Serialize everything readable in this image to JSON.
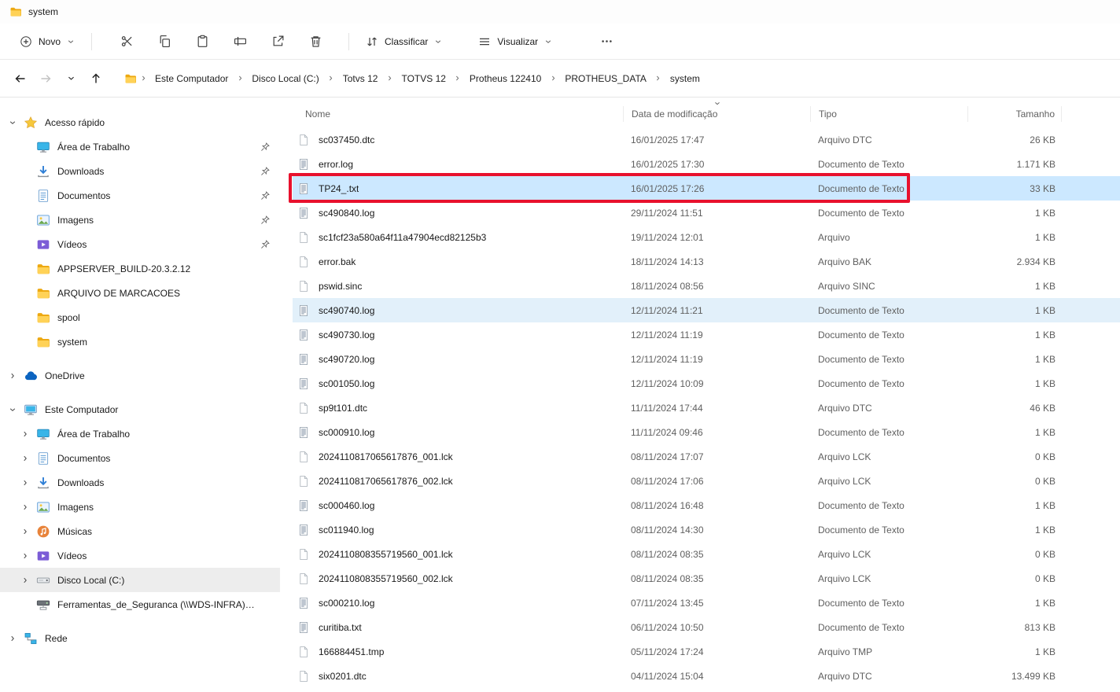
{
  "window": {
    "title": "system"
  },
  "toolbar": {
    "new": {
      "label": "Novo"
    },
    "sort": {
      "label": "Classificar"
    },
    "view": {
      "label": "Visualizar"
    }
  },
  "breadcrumb": {
    "items": [
      "Este Computador",
      "Disco Local (C:)",
      "Totvs 12",
      "TOTVS 12",
      "Protheus 122410",
      "PROTHEUS_DATA",
      "system"
    ]
  },
  "sidebar": {
    "items": [
      {
        "label": "Acesso rápido",
        "depth": 0,
        "icon": "star",
        "chevron": "down"
      },
      {
        "label": "Área de Trabalho",
        "depth": 1,
        "icon": "desktop",
        "pinned": true
      },
      {
        "label": "Downloads",
        "depth": 1,
        "icon": "downloads",
        "pinned": true
      },
      {
        "label": "Documentos",
        "depth": 1,
        "icon": "documents",
        "pinned": true
      },
      {
        "label": "Imagens",
        "depth": 1,
        "icon": "pictures",
        "pinned": true
      },
      {
        "label": "Vídeos",
        "depth": 1,
        "icon": "videos",
        "pinned": true
      },
      {
        "label": "APPSERVER_BUILD-20.3.2.12",
        "depth": 1,
        "icon": "folder"
      },
      {
        "label": "ARQUIVO DE MARCACOES",
        "depth": 1,
        "icon": "folder"
      },
      {
        "label": "spool",
        "depth": 1,
        "icon": "folder"
      },
      {
        "label": "system",
        "depth": 1,
        "icon": "folder"
      },
      {
        "label": "OneDrive",
        "depth": 0,
        "icon": "cloud",
        "chevron": "right",
        "gap": true
      },
      {
        "label": "Este Computador",
        "depth": 0,
        "icon": "computer",
        "chevron": "down",
        "gap": true
      },
      {
        "label": "Área de Trabalho",
        "depth": 1,
        "icon": "desktop",
        "chevron": "right"
      },
      {
        "label": "Documentos",
        "depth": 1,
        "icon": "documents",
        "chevron": "right"
      },
      {
        "label": "Downloads",
        "depth": 1,
        "icon": "downloads",
        "chevron": "right"
      },
      {
        "label": "Imagens",
        "depth": 1,
        "icon": "pictures",
        "chevron": "right"
      },
      {
        "label": "Músicas",
        "depth": 1,
        "icon": "music",
        "chevron": "right"
      },
      {
        "label": "Vídeos",
        "depth": 1,
        "icon": "videos",
        "chevron": "right"
      },
      {
        "label": "Disco Local (C:)",
        "depth": 1,
        "icon": "drive",
        "chevron": "right",
        "selected": true
      },
      {
        "label": "Ferramentas_de_Seguranca (\\\\WDS-INFRA) (K:)",
        "depth": 1,
        "icon": "netdrive"
      },
      {
        "label": "Rede",
        "depth": 0,
        "icon": "network",
        "chevron": "right",
        "gap": true
      }
    ]
  },
  "files": {
    "columns": [
      {
        "key": "name",
        "label": "Nome"
      },
      {
        "key": "date",
        "label": "Data de modificação",
        "sort": "desc"
      },
      {
        "key": "type",
        "label": "Tipo"
      },
      {
        "key": "size",
        "label": "Tamanho"
      }
    ],
    "rows": [
      {
        "name": "sc037450.dtc",
        "date": "16/01/2025 17:47",
        "type": "Arquivo DTC",
        "size": "26 KB",
        "icon": "file-blank"
      },
      {
        "name": "error.log",
        "date": "16/01/2025 17:30",
        "type": "Documento de Texto",
        "size": "1.171 KB",
        "icon": "file-text"
      },
      {
        "name": "TP24_.txt",
        "date": "16/01/2025 17:26",
        "type": "Documento de Texto",
        "size": "33 KB",
        "icon": "file-text",
        "state": "selected"
      },
      {
        "name": "sc490840.log",
        "date": "29/11/2024 11:51",
        "type": "Documento de Texto",
        "size": "1 KB",
        "icon": "file-text"
      },
      {
        "name": "sc1fcf23a580a64f11a47904ecd82125b3",
        "date": "19/11/2024 12:01",
        "type": "Arquivo",
        "size": "1 KB",
        "icon": "file-blank"
      },
      {
        "name": "error.bak",
        "date": "18/11/2024 14:13",
        "type": "Arquivo BAK",
        "size": "2.934 KB",
        "icon": "file-blank"
      },
      {
        "name": "pswid.sinc",
        "date": "18/11/2024 08:56",
        "type": "Arquivo SINC",
        "size": "1 KB",
        "icon": "file-blank"
      },
      {
        "name": "sc490740.log",
        "date": "12/11/2024 11:21",
        "type": "Documento de Texto",
        "size": "1 KB",
        "icon": "file-text",
        "state": "highlighted"
      },
      {
        "name": "sc490730.log",
        "date": "12/11/2024 11:19",
        "type": "Documento de Texto",
        "size": "1 KB",
        "icon": "file-text"
      },
      {
        "name": "sc490720.log",
        "date": "12/11/2024 11:19",
        "type": "Documento de Texto",
        "size": "1 KB",
        "icon": "file-text"
      },
      {
        "name": "sc001050.log",
        "date": "12/11/2024 10:09",
        "type": "Documento de Texto",
        "size": "1 KB",
        "icon": "file-text"
      },
      {
        "name": "sp9t101.dtc",
        "date": "11/11/2024 17:44",
        "type": "Arquivo DTC",
        "size": "46 KB",
        "icon": "file-blank"
      },
      {
        "name": "sc000910.log",
        "date": "11/11/2024 09:46",
        "type": "Documento de Texto",
        "size": "1 KB",
        "icon": "file-text"
      },
      {
        "name": "2024110817065617876_001.lck",
        "date": "08/11/2024 17:07",
        "type": "Arquivo LCK",
        "size": "0 KB",
        "icon": "file-blank"
      },
      {
        "name": "2024110817065617876_002.lck",
        "date": "08/11/2024 17:06",
        "type": "Arquivo LCK",
        "size": "0 KB",
        "icon": "file-blank"
      },
      {
        "name": "sc000460.log",
        "date": "08/11/2024 16:48",
        "type": "Documento de Texto",
        "size": "1 KB",
        "icon": "file-text"
      },
      {
        "name": "sc011940.log",
        "date": "08/11/2024 14:30",
        "type": "Documento de Texto",
        "size": "1 KB",
        "icon": "file-text"
      },
      {
        "name": "2024110808355719560_001.lck",
        "date": "08/11/2024 08:35",
        "type": "Arquivo LCK",
        "size": "0 KB",
        "icon": "file-blank"
      },
      {
        "name": "2024110808355719560_002.lck",
        "date": "08/11/2024 08:35",
        "type": "Arquivo LCK",
        "size": "0 KB",
        "icon": "file-blank"
      },
      {
        "name": "sc000210.log",
        "date": "07/11/2024 13:45",
        "type": "Documento de Texto",
        "size": "1 KB",
        "icon": "file-text"
      },
      {
        "name": "curitiba.txt",
        "date": "06/11/2024 10:50",
        "type": "Documento de Texto",
        "size": "813 KB",
        "icon": "file-text"
      },
      {
        "name": "166884451.tmp",
        "date": "05/11/2024 17:24",
        "type": "Arquivo TMP",
        "size": "1 KB",
        "icon": "file-blank"
      },
      {
        "name": "six0201.dtc",
        "date": "04/11/2024 15:04",
        "type": "Arquivo DTC",
        "size": "13.499 KB",
        "icon": "file-blank"
      }
    ]
  },
  "annotation": {
    "type": "red-box",
    "target_row": "TP24_.txt"
  },
  "colors": {
    "selection": "#cce8ff",
    "secondary_selection": "#e2f0fa",
    "annotation": "#e8112d",
    "sidebar_selection": "#ededed"
  }
}
